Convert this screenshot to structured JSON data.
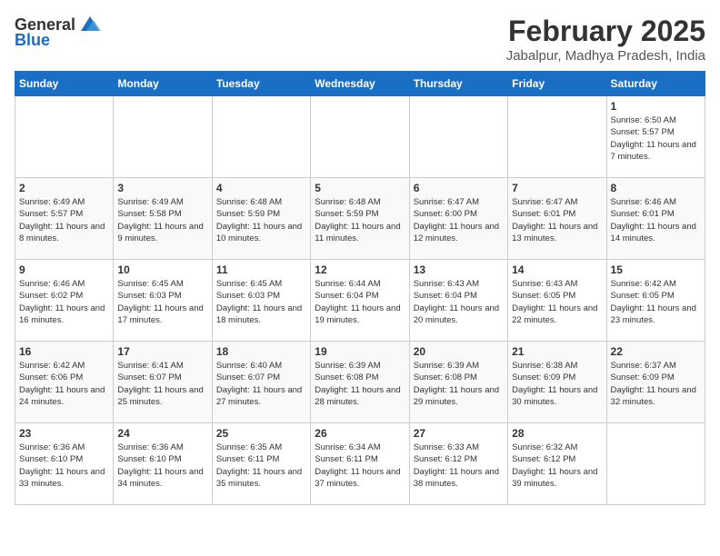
{
  "header": {
    "logo_general": "General",
    "logo_blue": "Blue",
    "month": "February 2025",
    "location": "Jabalpur, Madhya Pradesh, India"
  },
  "days_of_week": [
    "Sunday",
    "Monday",
    "Tuesday",
    "Wednesday",
    "Thursday",
    "Friday",
    "Saturday"
  ],
  "weeks": [
    [
      {
        "num": "",
        "info": ""
      },
      {
        "num": "",
        "info": ""
      },
      {
        "num": "",
        "info": ""
      },
      {
        "num": "",
        "info": ""
      },
      {
        "num": "",
        "info": ""
      },
      {
        "num": "",
        "info": ""
      },
      {
        "num": "1",
        "info": "Sunrise: 6:50 AM\nSunset: 5:57 PM\nDaylight: 11 hours and 7 minutes."
      }
    ],
    [
      {
        "num": "2",
        "info": "Sunrise: 6:49 AM\nSunset: 5:57 PM\nDaylight: 11 hours and 8 minutes."
      },
      {
        "num": "3",
        "info": "Sunrise: 6:49 AM\nSunset: 5:58 PM\nDaylight: 11 hours and 9 minutes."
      },
      {
        "num": "4",
        "info": "Sunrise: 6:48 AM\nSunset: 5:59 PM\nDaylight: 11 hours and 10 minutes."
      },
      {
        "num": "5",
        "info": "Sunrise: 6:48 AM\nSunset: 5:59 PM\nDaylight: 11 hours and 11 minutes."
      },
      {
        "num": "6",
        "info": "Sunrise: 6:47 AM\nSunset: 6:00 PM\nDaylight: 11 hours and 12 minutes."
      },
      {
        "num": "7",
        "info": "Sunrise: 6:47 AM\nSunset: 6:01 PM\nDaylight: 11 hours and 13 minutes."
      },
      {
        "num": "8",
        "info": "Sunrise: 6:46 AM\nSunset: 6:01 PM\nDaylight: 11 hours and 14 minutes."
      }
    ],
    [
      {
        "num": "9",
        "info": "Sunrise: 6:46 AM\nSunset: 6:02 PM\nDaylight: 11 hours and 16 minutes."
      },
      {
        "num": "10",
        "info": "Sunrise: 6:45 AM\nSunset: 6:03 PM\nDaylight: 11 hours and 17 minutes."
      },
      {
        "num": "11",
        "info": "Sunrise: 6:45 AM\nSunset: 6:03 PM\nDaylight: 11 hours and 18 minutes."
      },
      {
        "num": "12",
        "info": "Sunrise: 6:44 AM\nSunset: 6:04 PM\nDaylight: 11 hours and 19 minutes."
      },
      {
        "num": "13",
        "info": "Sunrise: 6:43 AM\nSunset: 6:04 PM\nDaylight: 11 hours and 20 minutes."
      },
      {
        "num": "14",
        "info": "Sunrise: 6:43 AM\nSunset: 6:05 PM\nDaylight: 11 hours and 22 minutes."
      },
      {
        "num": "15",
        "info": "Sunrise: 6:42 AM\nSunset: 6:05 PM\nDaylight: 11 hours and 23 minutes."
      }
    ],
    [
      {
        "num": "16",
        "info": "Sunrise: 6:42 AM\nSunset: 6:06 PM\nDaylight: 11 hours and 24 minutes."
      },
      {
        "num": "17",
        "info": "Sunrise: 6:41 AM\nSunset: 6:07 PM\nDaylight: 11 hours and 25 minutes."
      },
      {
        "num": "18",
        "info": "Sunrise: 6:40 AM\nSunset: 6:07 PM\nDaylight: 11 hours and 27 minutes."
      },
      {
        "num": "19",
        "info": "Sunrise: 6:39 AM\nSunset: 6:08 PM\nDaylight: 11 hours and 28 minutes."
      },
      {
        "num": "20",
        "info": "Sunrise: 6:39 AM\nSunset: 6:08 PM\nDaylight: 11 hours and 29 minutes."
      },
      {
        "num": "21",
        "info": "Sunrise: 6:38 AM\nSunset: 6:09 PM\nDaylight: 11 hours and 30 minutes."
      },
      {
        "num": "22",
        "info": "Sunrise: 6:37 AM\nSunset: 6:09 PM\nDaylight: 11 hours and 32 minutes."
      }
    ],
    [
      {
        "num": "23",
        "info": "Sunrise: 6:36 AM\nSunset: 6:10 PM\nDaylight: 11 hours and 33 minutes."
      },
      {
        "num": "24",
        "info": "Sunrise: 6:36 AM\nSunset: 6:10 PM\nDaylight: 11 hours and 34 minutes."
      },
      {
        "num": "25",
        "info": "Sunrise: 6:35 AM\nSunset: 6:11 PM\nDaylight: 11 hours and 35 minutes."
      },
      {
        "num": "26",
        "info": "Sunrise: 6:34 AM\nSunset: 6:11 PM\nDaylight: 11 hours and 37 minutes."
      },
      {
        "num": "27",
        "info": "Sunrise: 6:33 AM\nSunset: 6:12 PM\nDaylight: 11 hours and 38 minutes."
      },
      {
        "num": "28",
        "info": "Sunrise: 6:32 AM\nSunset: 6:12 PM\nDaylight: 11 hours and 39 minutes."
      },
      {
        "num": "",
        "info": ""
      }
    ]
  ]
}
